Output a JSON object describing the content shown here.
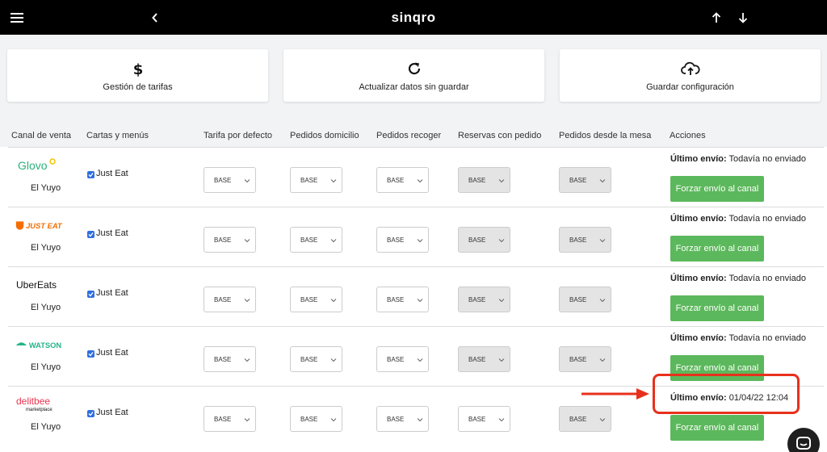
{
  "topbar": {
    "brand": "sinqro",
    "icons": [
      "menu-icon",
      "chevron-left-icon",
      "arrow-up-icon",
      "arrow-down-icon"
    ]
  },
  "cards": [
    {
      "icon": "dollar-icon",
      "label": "Gestión de tarifas"
    },
    {
      "icon": "refresh-icon",
      "label": "Actualizar datos sin guardar"
    },
    {
      "icon": "cloud-upload-icon",
      "label": "Guardar configuración"
    }
  ],
  "table": {
    "headers": [
      "Canal de venta",
      "Cartas y menús",
      "Tarifa por defecto",
      "Pedidos domicilio",
      "Pedidos recoger",
      "Reservas con pedido",
      "Pedidos desde la mesa",
      "Acciones"
    ],
    "rows": [
      {
        "channel": "Glovo",
        "store": "El Yuyo",
        "menu": "Just Eat",
        "menu_checked": true,
        "tarifas": [
          "BASE",
          "BASE",
          "BASE",
          "BASE",
          "BASE"
        ],
        "disabled": [
          false,
          false,
          false,
          true,
          true
        ],
        "last_label": "Último envío:",
        "last_value": "Todavía no enviado",
        "button": "Forzar envío al canal"
      },
      {
        "channel": "JUST EAT",
        "store": "El Yuyo",
        "menu": "Just Eat",
        "menu_checked": true,
        "tarifas": [
          "BASE",
          "BASE",
          "BASE",
          "BASE",
          "BASE"
        ],
        "disabled": [
          false,
          false,
          false,
          true,
          true
        ],
        "last_label": "Último envío:",
        "last_value": "Todavía no enviado",
        "button": "Forzar envío al canal"
      },
      {
        "channel": "UberEats",
        "store": "El Yuyo",
        "menu": "Just Eat",
        "menu_checked": true,
        "tarifas": [
          "BASE",
          "BASE",
          "BASE",
          "BASE",
          "BASE"
        ],
        "disabled": [
          false,
          false,
          false,
          true,
          true
        ],
        "last_label": "Último envío:",
        "last_value": "Todavía no enviado",
        "button": "Forzar envío al canal"
      },
      {
        "channel": "WATSON",
        "store": "El Yuyo",
        "menu": "Just Eat",
        "menu_checked": true,
        "tarifas": [
          "BASE",
          "BASE",
          "BASE",
          "BASE",
          "BASE"
        ],
        "disabled": [
          false,
          false,
          false,
          true,
          true
        ],
        "last_label": "Último envío:",
        "last_value": "Todavía no enviado",
        "button": "Forzar envío al canal"
      },
      {
        "channel": "delitbee",
        "channel_sub": "marketplace",
        "store": "El Yuyo",
        "menu": "Just Eat",
        "menu_checked": true,
        "tarifas": [
          "BASE",
          "BASE",
          "BASE",
          "BASE",
          "BASE"
        ],
        "disabled": [
          false,
          false,
          false,
          false,
          true
        ],
        "last_label": "Último envío:",
        "last_value": "01/04/22 12:04",
        "button": "Forzar envío al canal"
      }
    ]
  },
  "colors": {
    "topbar": "#000000",
    "button_green": "#5cb85c",
    "annotation_red": "#e8301c",
    "glovo": "#2bb27b",
    "justeat": "#f36d00",
    "watson": "#25b38a",
    "delitbee": "#e8344e"
  }
}
